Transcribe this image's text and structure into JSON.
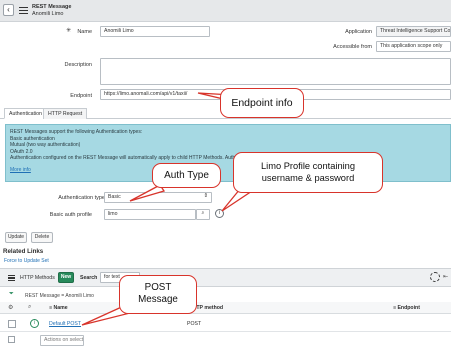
{
  "header": {
    "title": "REST Message",
    "subtitle": "Anomili Limo"
  },
  "form": {
    "name_label": "Name",
    "name_value": "Anomili Limo",
    "application_label": "Application",
    "application_value": "Threat Intelligence Support Com",
    "accessible_label": "Accessible from",
    "accessible_value": "This application scope only",
    "description_label": "Description",
    "description_value": "",
    "endpoint_label": "Endpoint",
    "endpoint_value": "https://limo.anomali.com/api/v1/taxii/"
  },
  "tabs": [
    {
      "label": "Authentication"
    },
    {
      "label": "HTTP Request"
    }
  ],
  "info_box": {
    "lines": [
      "REST Messages support the following Authentication types:",
      "Basic authentication",
      "Mutual (two way authentication)",
      "OAuth 2.0",
      "Authentication configured on the REST Message will automatically apply to child HTTP Methods. Authen"
    ],
    "more_info": "More info"
  },
  "auth": {
    "type_label": "Authentication type",
    "type_value": "Basic",
    "profile_label": "Basic auth profile",
    "profile_value": "limo"
  },
  "buttons": {
    "update": "Update",
    "delete": "Delete"
  },
  "related": {
    "title": "Related Links",
    "force_link": "Force to Update Set"
  },
  "related_list": {
    "tab_label": "HTTP Methods",
    "new_button": "New",
    "search_label": "Search",
    "search_value": "for text",
    "breadcrumb": "REST Message = Anomili Limo",
    "col_name": "Name",
    "col_method": "HTTP method",
    "col_endpoint": "Endpoint",
    "rows": [
      {
        "name": "Default POST",
        "method": "POST",
        "endpoint": ""
      }
    ],
    "actions_placeholder": "Actions on selected rows..."
  },
  "callouts": {
    "endpoint": "Endpoint info",
    "auth_type": "Auth Type",
    "profile_line1": "Limo Profile containing",
    "profile_line2": "username & password",
    "post_line1": "POST",
    "post_line2": "Message"
  },
  "colors": {
    "info_bg": "#a6d9e3",
    "callout_border": "#d8342b",
    "new_button": "#278a5b",
    "link": "#1f6fb5"
  }
}
